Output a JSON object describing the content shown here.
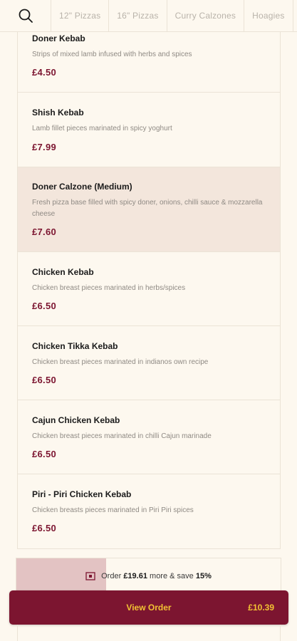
{
  "nav": {
    "tabs": [
      "12\" Pizzas",
      "16\" Pizzas",
      "Curry Calzones",
      "Hoagies"
    ]
  },
  "items": [
    {
      "name": "Doner Kebab",
      "desc": "Strips of mixed lamb infused with herbs and spices",
      "price": "£4.50"
    },
    {
      "name": "Shish Kebab",
      "desc": "Lamb fillet pieces marinated in spicy yoghurt",
      "price": "£7.99"
    },
    {
      "name": "Doner Calzone (Medium)",
      "desc": "Fresh pizza base filled with spicy doner, onions, chilli sauce & mozzarella cheese",
      "price": "£7.60"
    },
    {
      "name": "Chicken Kebab",
      "desc": "Chicken breast pieces marinated in herbs/spices",
      "price": "£6.50"
    },
    {
      "name": "Chicken Tikka Kebab",
      "desc": "Chicken breast pieces marinated in indianos own recipe",
      "price": "£6.50"
    },
    {
      "name": "Cajun Chicken Kebab",
      "desc": "Chicken breast pieces marinated in chilli Cajun marinade",
      "price": "£6.50"
    },
    {
      "name": "Piri - Piri Chicken Kebab",
      "desc": "Chicken breasts pieces marinated in Piri Piri spices",
      "price": "£6.50"
    }
  ],
  "promo": {
    "prefix": "Order",
    "amount": "£19.61",
    "middle": "more & save",
    "percent": "15%",
    "progress": 0.34
  },
  "order": {
    "label": "View Order",
    "total": "£10.39"
  },
  "colors": {
    "accent": "#7c1530",
    "button_text": "#f2c233",
    "highlight": "#f3e6dc",
    "background": "#fdf8ef"
  }
}
